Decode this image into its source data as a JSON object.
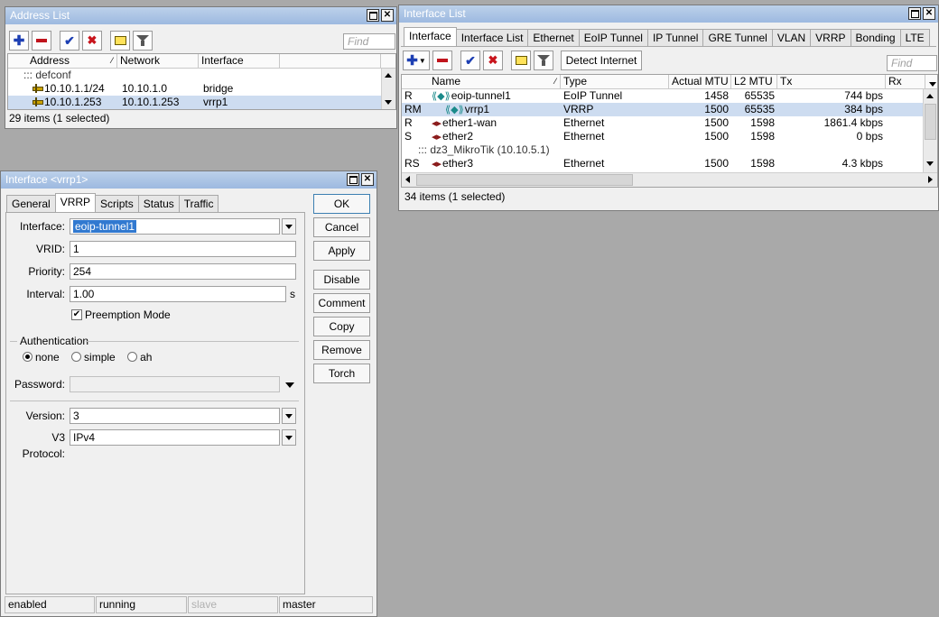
{
  "address_list": {
    "title": "Address List",
    "find_placeholder": "Find",
    "columns": [
      "Address",
      "Network",
      "Interface"
    ],
    "group": "::: defconf",
    "rows": [
      {
        "address": "10.10.1.1/24",
        "network": "10.10.1.0",
        "interface": "bridge",
        "selected": false
      },
      {
        "address": "10.10.1.253",
        "network": "10.10.1.253",
        "interface": "vrrp1",
        "selected": true
      }
    ],
    "status": "29 items (1 selected)"
  },
  "interface_list": {
    "title": "Interface List",
    "tabs": [
      "Interface",
      "Interface List",
      "Ethernet",
      "EoIP Tunnel",
      "IP Tunnel",
      "GRE Tunnel",
      "VLAN",
      "VRRP",
      "Bonding",
      "LTE"
    ],
    "active_tab": "Interface",
    "detect_button": "Detect Internet",
    "find_placeholder": "Find",
    "columns": [
      "Name",
      "Type",
      "Actual MTU",
      "L2 MTU",
      "Tx",
      "Rx"
    ],
    "rows": [
      {
        "flag": "R",
        "name": "eoip-tunnel1",
        "type": "EoIP Tunnel",
        "mtu": "1458",
        "l2mtu": "65535",
        "tx": "744 bps",
        "icon": "eoip"
      },
      {
        "flag": "RM",
        "name": "vrrp1",
        "type": "VRRP",
        "mtu": "1500",
        "l2mtu": "65535",
        "tx": "384 bps",
        "icon": "eoip",
        "selected": true
      },
      {
        "flag": "R",
        "name": "ether1-wan",
        "type": "Ethernet",
        "mtu": "1500",
        "l2mtu": "1598",
        "tx": "1861.4 kbps",
        "icon": "eth"
      },
      {
        "flag": "S",
        "name": "ether2",
        "type": "Ethernet",
        "mtu": "1500",
        "l2mtu": "1598",
        "tx": "0 bps",
        "icon": "eth"
      },
      {
        "group": "::: dz3_MikroTik (10.10.5.1)"
      },
      {
        "flag": "RS",
        "name": "ether3",
        "type": "Ethernet",
        "mtu": "1500",
        "l2mtu": "1598",
        "tx": "4.3 kbps",
        "icon": "eth"
      }
    ],
    "status": "34 items (1 selected)"
  },
  "vrrp_dialog": {
    "title": "Interface <vrrp1>",
    "tabs": [
      "General",
      "VRRP",
      "Scripts",
      "Status",
      "Traffic"
    ],
    "active_tab": "VRRP",
    "fields": {
      "interface_label": "Interface:",
      "interface_value": "eoip-tunnel1",
      "vrid_label": "VRID:",
      "vrid_value": "1",
      "priority_label": "Priority:",
      "priority_value": "254",
      "interval_label": "Interval:",
      "interval_value": "1.00",
      "interval_unit": "s",
      "preemption_label": "Preemption Mode",
      "preemption_checked": true,
      "auth_section": "Authentication",
      "auth_options": [
        "none",
        "simple",
        "ah"
      ],
      "auth_selected": "none",
      "password_label": "Password:",
      "password_value": "",
      "version_label": "Version:",
      "version_value": "3",
      "v3_protocol_label": "V3 Protocol:",
      "v3_protocol_value": "IPv4"
    },
    "buttons": {
      "ok": "OK",
      "cancel": "Cancel",
      "apply": "Apply",
      "disable": "Disable",
      "comment": "Comment",
      "copy": "Copy",
      "remove": "Remove",
      "torch": "Torch"
    },
    "statusbar": [
      "enabled",
      "running",
      "slave",
      "master"
    ]
  },
  "colors": {
    "desktop": "#a9a9a9",
    "selection": "#cddcf0",
    "field_selection": "#3179d0"
  }
}
